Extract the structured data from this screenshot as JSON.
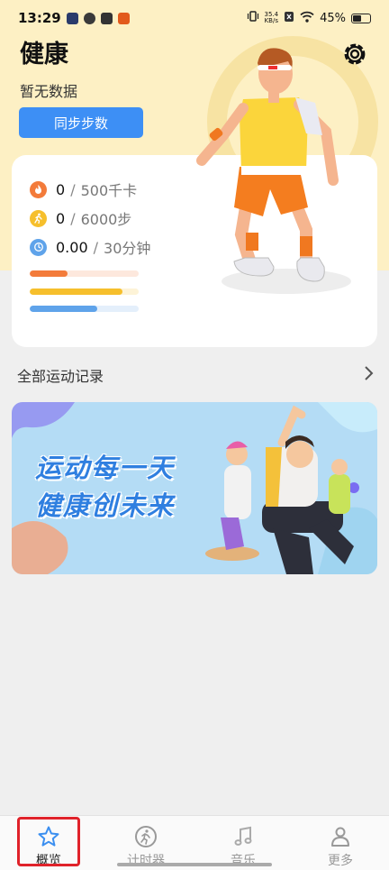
{
  "status_bar": {
    "time": "13:29",
    "net_speed_value": "35.4",
    "net_speed_unit": "KB/s",
    "battery": "45%"
  },
  "header": {
    "title": "健康",
    "no_data": "暂无数据",
    "sync_button": "同步步数"
  },
  "summary": {
    "stats": [
      {
        "icon": "flame-icon",
        "value": "0",
        "goal": "500千卡",
        "color": "#f37b3a",
        "fraction": 0.35
      },
      {
        "icon": "runner-icon",
        "value": "0",
        "goal": "6000步",
        "color": "#f6bf2c",
        "fraction": 0.85
      },
      {
        "icon": "clock-icon",
        "value": "0.00",
        "goal": "30分钟",
        "color": "#5fa3ea",
        "fraction": 0.62
      }
    ],
    "separator": "/"
  },
  "records": {
    "label": "全部运动记录"
  },
  "banner": {
    "line1": "运动每一天",
    "line2": "健康创未来"
  },
  "tabbar": {
    "tabs": [
      {
        "label": "概览",
        "icon": "star-icon",
        "active": true
      },
      {
        "label": "计时器",
        "icon": "runner-circle-icon",
        "active": false
      },
      {
        "label": "音乐",
        "icon": "music-note-icon",
        "active": false
      },
      {
        "label": "更多",
        "icon": "person-icon",
        "active": false
      }
    ]
  }
}
